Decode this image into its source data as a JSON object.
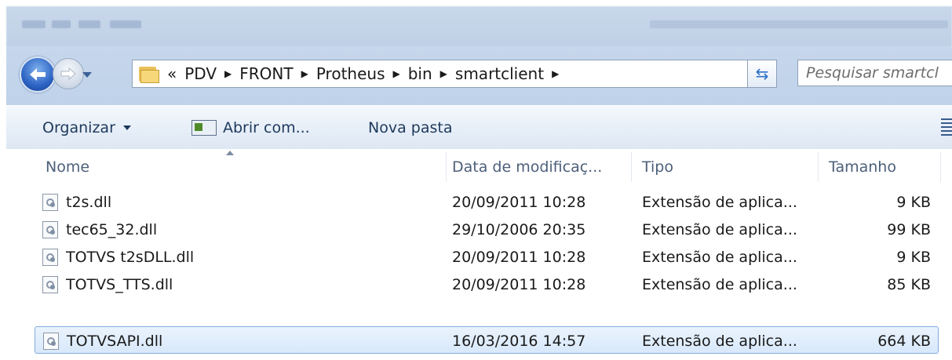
{
  "address": {
    "overflow": "«",
    "crumbs": [
      "PDV",
      "FRONT",
      "Protheus",
      "bin",
      "smartclient"
    ],
    "search_placeholder": "Pesquisar smartcl"
  },
  "toolbar": {
    "organize": "Organizar",
    "open_with": "Abrir com...",
    "new_folder": "Nova pasta"
  },
  "columns": {
    "name": "Nome",
    "date": "Data de modificaç...",
    "type": "Tipo",
    "size": "Tamanho"
  },
  "files": [
    {
      "name": "t2s.dll",
      "date": "20/09/2011 10:28",
      "type": "Extensão de aplica...",
      "size": "9 KB"
    },
    {
      "name": "tec65_32.dll",
      "date": "29/10/2006 20:35",
      "type": "Extensão de aplica...",
      "size": "99 KB"
    },
    {
      "name": "TOTVS t2sDLL.dll",
      "date": "20/09/2011 10:28",
      "type": "Extensão de aplica...",
      "size": "9 KB"
    },
    {
      "name": "TOTVS_TTS.dll",
      "date": "20/09/2011 10:28",
      "type": "Extensão de aplica...",
      "size": "85 KB"
    },
    {
      "name": "TOTVSAPI.dll",
      "date": "16/03/2016 14:57",
      "type": "Extensão de aplica...",
      "size": "664 KB",
      "selected": true
    }
  ],
  "colors": {
    "selection_border": "#84acdd",
    "header_text": "#4c607a",
    "toolbar_text": "#1e395b"
  }
}
